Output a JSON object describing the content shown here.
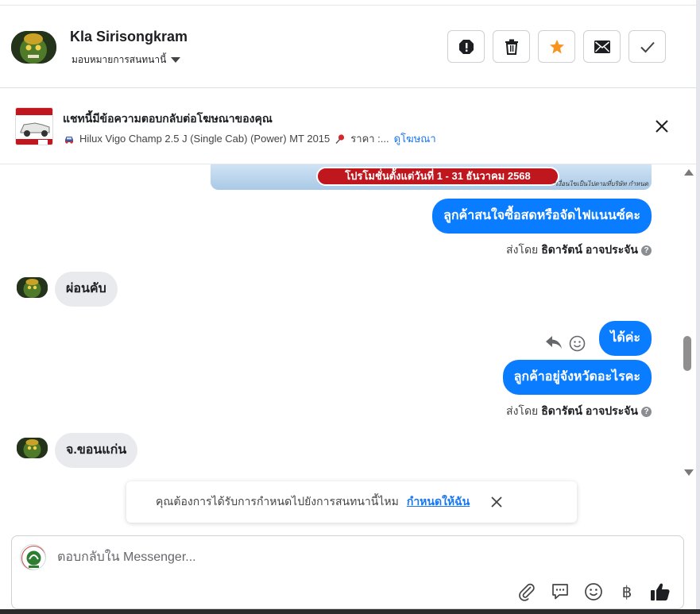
{
  "header": {
    "contact_name": "Kla Sirisongkram",
    "assign_label": "มอบหมายการสนทนานี้",
    "actions": [
      "spam-icon",
      "trash-icon",
      "star-icon",
      "mail-icon",
      "check-icon"
    ]
  },
  "ad_banner": {
    "title": "แชทนี้มีข้อความตอบกลับต่อโฆษณาของคุณ",
    "product": "Hilux Vigo Champ 2.5 J (Single Cab) (Power) MT 2015",
    "price_label": "ราคา :...",
    "link": "ดูโฆษณา"
  },
  "promo": {
    "text": "โปรโมชั่นตั้งแต่วันที่ 1 - 31 ธันวาคม 2568",
    "note": "*เงื่อนไขเป็นไปตามที่บริษัท กำหนด"
  },
  "messages": {
    "m1": "ลูกค้าสนใจซื้อสดหรือจัดไฟแนนซ์คะ",
    "sent_by_1_prefix": "ส่งโดย",
    "sent_by_1_name": "ธิดารัตน์ อาจประจัน",
    "m2": "ผ่อนคับ",
    "m3": "ได้ค่ะ",
    "m4": "ลูกค้าอยู่จังหวัดอะไรคะ",
    "sent_by_2_prefix": "ส่งโดย",
    "sent_by_2_name": "ธิดารัตน์ อาจประจัน",
    "m5": "จ.ขอนแก่น"
  },
  "toast": {
    "text": "คุณต้องการได้รับการกำหนดไปยังการสนทนานี้ไหม",
    "link": "กำหนดให้ฉัน"
  },
  "composer": {
    "placeholder": "ตอบกลับใน Messenger...",
    "currency_symbol": "฿",
    "tools": [
      "attach-icon",
      "saved-reply-icon",
      "emoji-icon",
      "baht-icon",
      "like-icon"
    ]
  },
  "colors": {
    "accent": "#0a7cff",
    "link": "#1877f2",
    "star": "#f7931e"
  }
}
